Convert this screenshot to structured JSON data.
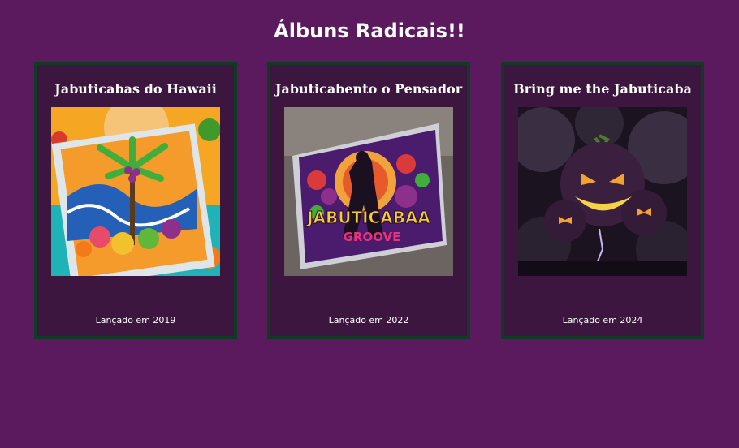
{
  "page": {
    "title": "Álbuns Radicais!!"
  },
  "albums": [
    {
      "title": "Jabuticabas do Hawaii",
      "release": "Lançado em 2019",
      "cover_style": "tropical"
    },
    {
      "title": "Jabuticabento o Pensador",
      "release": "Lançado em 2022",
      "cover_style": "singer-silhouette",
      "cover_text": [
        "JABUTICABAA",
        "GROOVE"
      ]
    },
    {
      "title": "Bring me the Jabuticaba",
      "release": "Lançado em 2024",
      "cover_style": "dark-monsters"
    }
  ],
  "colors": {
    "background": "#5c1a5e",
    "card": "#3d1640",
    "card_border": "#0e3b22",
    "text": "#ffffff"
  }
}
